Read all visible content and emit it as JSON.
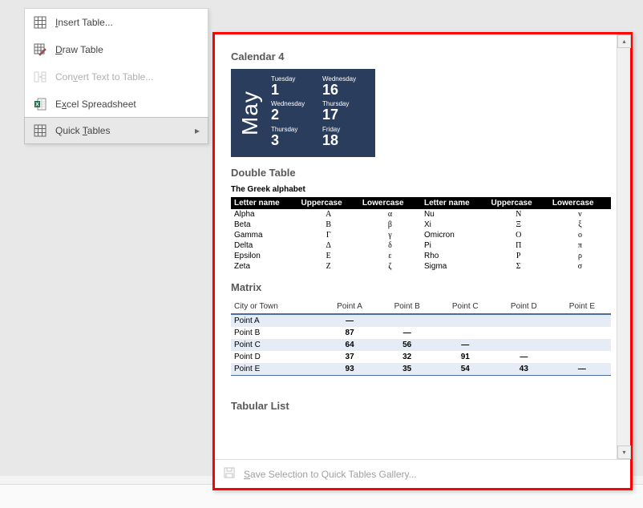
{
  "menu": {
    "insert_table": "Insert Table...",
    "draw_table": "Draw Table",
    "convert": "Convert Text to Table...",
    "excel": "Excel Spreadsheet",
    "quick_tables": "Quick Tables"
  },
  "gallery": {
    "calendar4": {
      "title": "Calendar 4",
      "month": "May",
      "cells": [
        {
          "dow": "Tuesday",
          "num": "1"
        },
        {
          "dow": "Wednesday",
          "num": "16"
        },
        {
          "dow": "Wednesday",
          "num": "2"
        },
        {
          "dow": "Thursday",
          "num": "17"
        },
        {
          "dow": "Thursday",
          "num": "3"
        },
        {
          "dow": "Friday",
          "num": "18"
        }
      ]
    },
    "double_table": {
      "title": "Double Table",
      "caption": "The Greek alphabet",
      "headers": [
        "Letter name",
        "Uppercase",
        "Lowercase",
        "Letter name",
        "Uppercase",
        "Lowercase"
      ],
      "rows": [
        [
          "Alpha",
          "Α",
          "α",
          "Nu",
          "Ν",
          "ν"
        ],
        [
          "Beta",
          "Β",
          "β",
          "Xi",
          "Ξ",
          "ξ"
        ],
        [
          "Gamma",
          "Γ",
          "γ",
          "Omicron",
          "Ο",
          "ο"
        ],
        [
          "Delta",
          "Δ",
          "δ",
          "Pi",
          "Π",
          "π"
        ],
        [
          "Epsilon",
          "Ε",
          "ε",
          "Rho",
          "Ρ",
          "ρ"
        ],
        [
          "Zeta",
          "Ζ",
          "ζ",
          "Sigma",
          "Σ",
          "σ"
        ]
      ]
    },
    "matrix": {
      "title": "Matrix",
      "headers": [
        "City or Town",
        "Point A",
        "Point B",
        "Point C",
        "Point D",
        "Point E"
      ],
      "rows": [
        [
          "Point A",
          "—",
          "",
          "",
          "",
          ""
        ],
        [
          "Point B",
          "87",
          "—",
          "",
          "",
          ""
        ],
        [
          "Point C",
          "64",
          "56",
          "—",
          "",
          ""
        ],
        [
          "Point D",
          "37",
          "32",
          "91",
          "—",
          ""
        ],
        [
          "Point E",
          "93",
          "35",
          "54",
          "43",
          "—"
        ]
      ]
    },
    "tabular_list": {
      "title": "Tabular List"
    },
    "footer": "Save Selection to Quick Tables Gallery..."
  }
}
